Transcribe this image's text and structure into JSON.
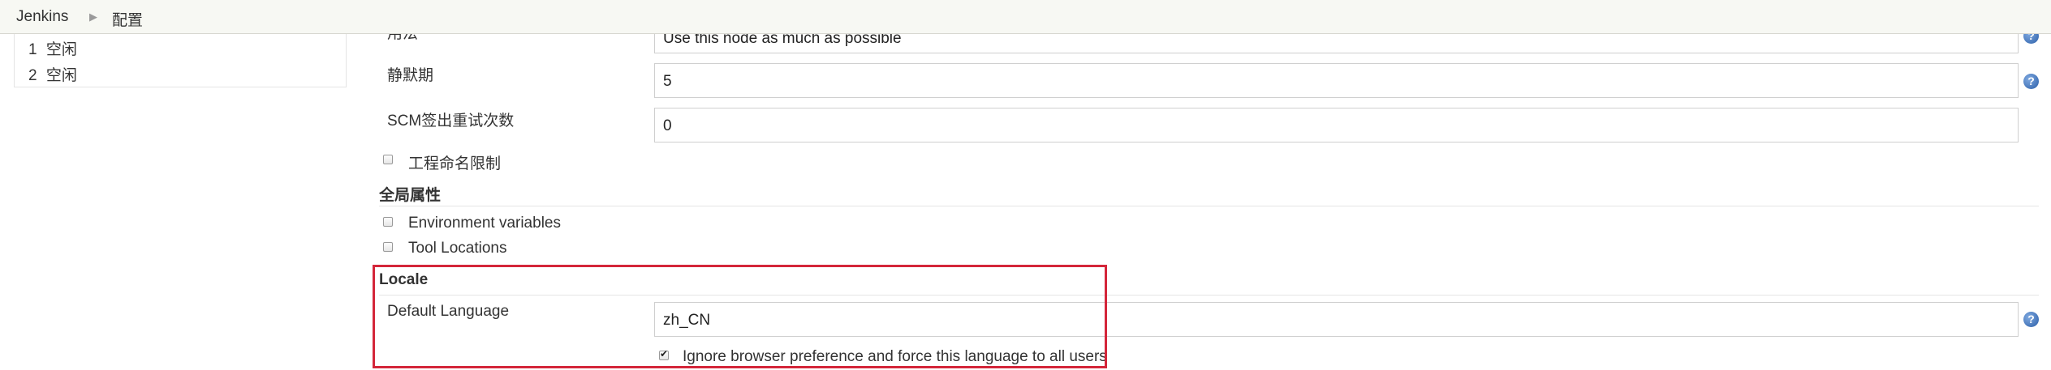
{
  "breadcrumb": {
    "home": "Jenkins",
    "current": "配置"
  },
  "executors": [
    {
      "num": "1",
      "status": "空闲"
    },
    {
      "num": "2",
      "status": "空闲"
    }
  ],
  "form": {
    "usage": {
      "label": "用法",
      "value": "Use this node as much as possible"
    },
    "quiet_period": {
      "label": "静默期",
      "value": "5"
    },
    "scm_retry": {
      "label": "SCM签出重试次数",
      "value": "0"
    },
    "restrict_names": {
      "label": "工程命名限制",
      "checked": false
    }
  },
  "global_properties": {
    "title": "全局属性",
    "env_vars": {
      "label": "Environment variables",
      "checked": false
    },
    "tool_locations": {
      "label": "Tool Locations",
      "checked": false
    }
  },
  "locale": {
    "title": "Locale",
    "default_language": {
      "label": "Default Language",
      "value": "zh_CN"
    },
    "ignore_browser": {
      "label": "Ignore browser preference and force this language to all users",
      "checked": true
    }
  },
  "help_icon": "?",
  "colors": {
    "highlight_border": "#d4263a",
    "help_icon": "#2b5ea8"
  }
}
